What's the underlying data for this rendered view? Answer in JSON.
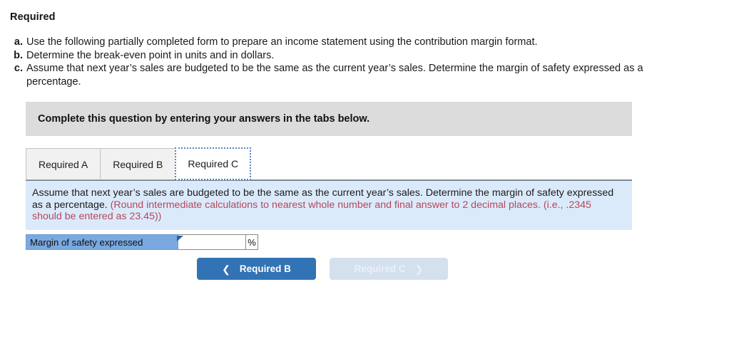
{
  "page": {
    "required_heading": "Required"
  },
  "instructions": [
    {
      "letter": "a.",
      "text": "Use the following partially completed form to prepare an income statement using the contribution margin format."
    },
    {
      "letter": "b.",
      "text": "Determine the break-even point in units and in dollars."
    },
    {
      "letter": "c.",
      "text": "Assume that next year’s sales are budgeted to be the same as the current year’s sales. Determine the margin of safety expressed as a percentage."
    }
  ],
  "banner": {
    "text": "Complete this question by entering your answers in the tabs below."
  },
  "tabs": [
    {
      "label": "Required A",
      "active": false
    },
    {
      "label": "Required B",
      "active": false
    },
    {
      "label": "Required C",
      "active": true
    }
  ],
  "info_panel": {
    "text": "Assume that next year’s sales are budgeted to be the same as the current year’s sales. Determine the margin of safety expressed as a percentage.",
    "note": "(Round intermediate calculations to nearest whole number and final answer to 2 decimal places. (i.e., .2345 should be entered as 23.45))"
  },
  "answer_row": {
    "label": "Margin of safety expressed",
    "value": "",
    "placeholder": "",
    "unit": "%"
  },
  "nav": {
    "prev_label": "Required B",
    "next_label": "Required C",
    "prev_icon": "chevron-left-icon",
    "next_icon": "chevron-right-icon"
  },
  "colors": {
    "banner_bg": "#dcdcdc",
    "info_panel_bg": "#dbeafb",
    "note_red": "#b5485a",
    "label_blue": "#7aa9e0",
    "primary_button": "#3273b5",
    "disabled_button": "#d5e0ee"
  }
}
